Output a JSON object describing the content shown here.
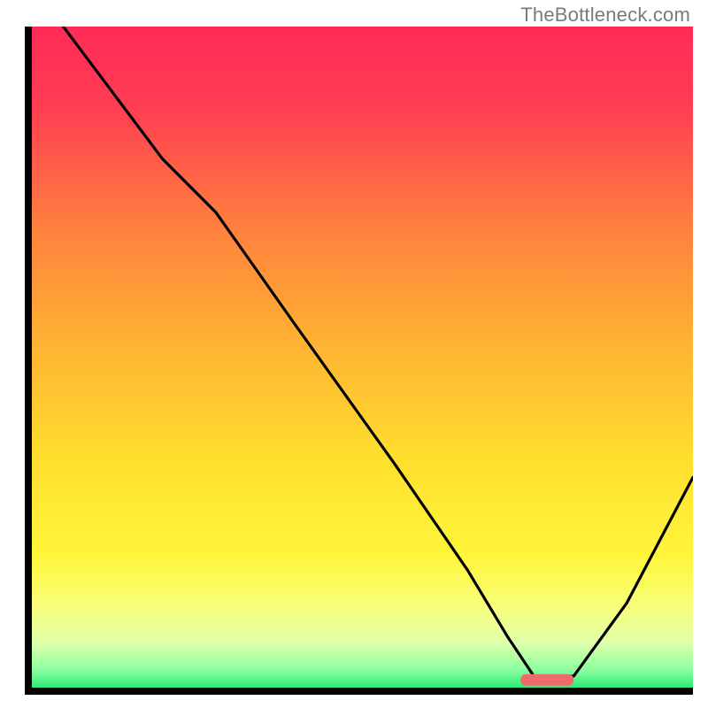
{
  "watermark": "TheBottleneck.com",
  "chart_data": {
    "type": "line",
    "title": "",
    "xlabel": "",
    "ylabel": "",
    "xlim": [
      0,
      100
    ],
    "ylim": [
      0,
      100
    ],
    "grid": false,
    "legend": false,
    "series": [
      {
        "name": "curve",
        "x": [
          5,
          20,
          28,
          40,
          55,
          66,
          72,
          76,
          82,
          90,
          100
        ],
        "y": [
          100,
          80,
          72,
          55,
          34,
          18,
          8,
          2,
          2,
          13,
          32
        ],
        "note": "y is percentage height from bottom; curve dips to minimum around x≈76–82 then rises"
      }
    ],
    "marker": {
      "note": "short horizontal red segment near bottom at the minimum",
      "x_start": 74,
      "x_end": 82,
      "y": 1.5
    },
    "background": "vertical gradient red→orange→yellow→pale-yellow→green (top→bottom)",
    "axes": "black L-frame on left and bottom, thick"
  }
}
